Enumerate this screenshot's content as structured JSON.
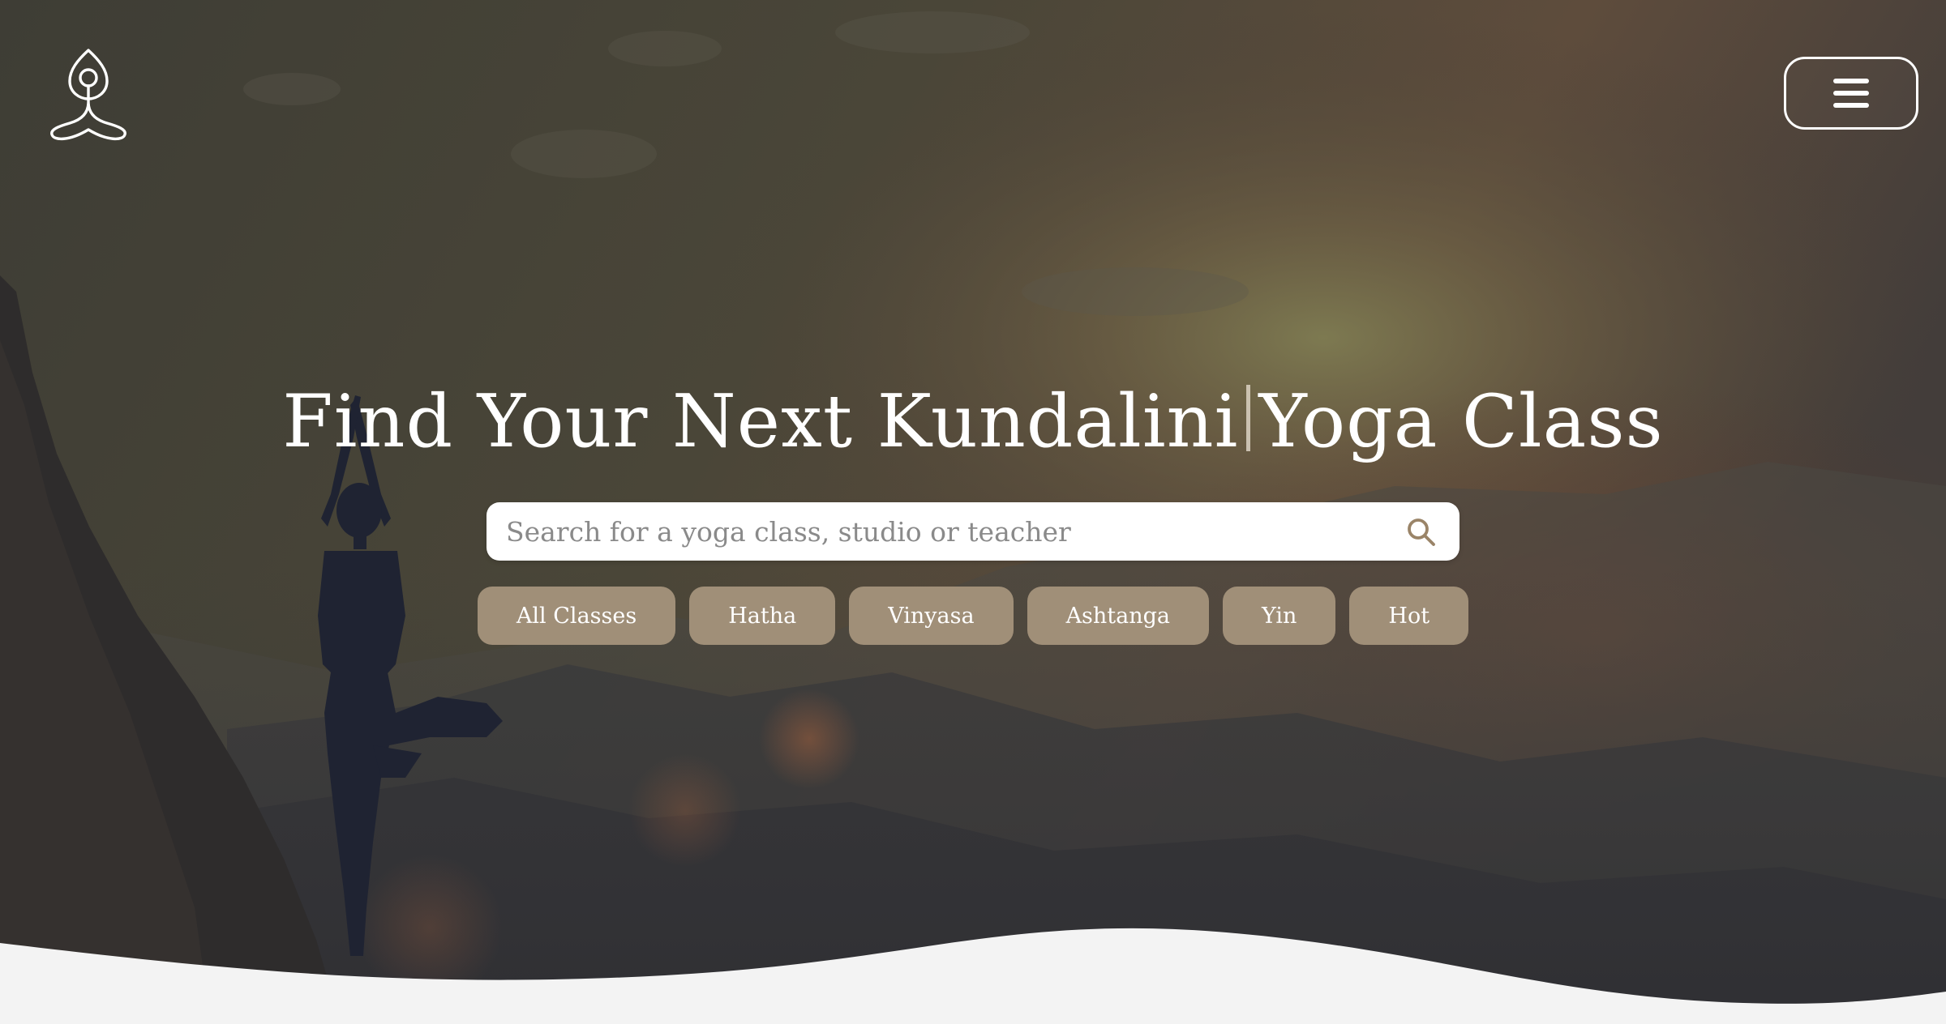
{
  "brand": {
    "logo_icon": "meditation-pose-icon"
  },
  "header": {
    "menu_icon": "hamburger-menu-icon"
  },
  "hero": {
    "headline_prefix": "Find Your Next Kundalini",
    "headline_suffix": "Yoga Class"
  },
  "search": {
    "placeholder": "Search for a yoga class, studio or teacher",
    "value": "",
    "icon": "search-icon"
  },
  "filters": [
    {
      "label": "All Classes"
    },
    {
      "label": "Hatha"
    },
    {
      "label": "Vinyasa"
    },
    {
      "label": "Ashtanga"
    },
    {
      "label": "Yin"
    },
    {
      "label": "Hot"
    }
  ],
  "colors": {
    "pill_background": "#a08f78",
    "page_background": "#f3f3f3",
    "search_icon": "#9a8468"
  }
}
